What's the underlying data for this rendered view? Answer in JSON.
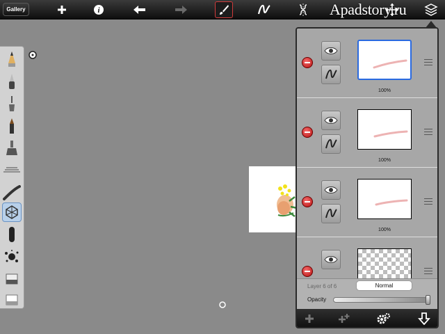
{
  "toolbar": {
    "gallery_label": "Gallery",
    "watermark": "Apadstory.ru",
    "icons": [
      "add-icon",
      "info-icon",
      "undo-icon",
      "redo-icon",
      "brush-icon",
      "stroke-icon",
      "symmetry-icon",
      "text-icon",
      "transform-icon",
      "layers-icon"
    ]
  },
  "palette": {
    "tools": [
      "pencil",
      "ink-pen",
      "fine-brush",
      "marker",
      "airbrush",
      "ruler-brush",
      "soft-brush",
      "sticker-brush",
      "smudge",
      "splatter",
      "eraser-hard",
      "eraser-soft"
    ],
    "selected": "sticker-brush"
  },
  "layers_panel": {
    "layers": [
      {
        "opacity": "100%",
        "selected": true,
        "empty": false
      },
      {
        "opacity": "100%",
        "selected": false,
        "empty": false
      },
      {
        "opacity": "100%",
        "selected": false,
        "empty": false
      },
      {
        "opacity": "",
        "selected": false,
        "empty": true
      }
    ],
    "layer_count": "Layer 6 of 6",
    "blend_mode": "Normal",
    "opacity_label": "Opacity",
    "opacity_value": 1.0
  },
  "colors": {
    "accent_selected": "#2a6ae0",
    "active_tool_border": "#d23b3b",
    "delete_red": "#c41414"
  }
}
